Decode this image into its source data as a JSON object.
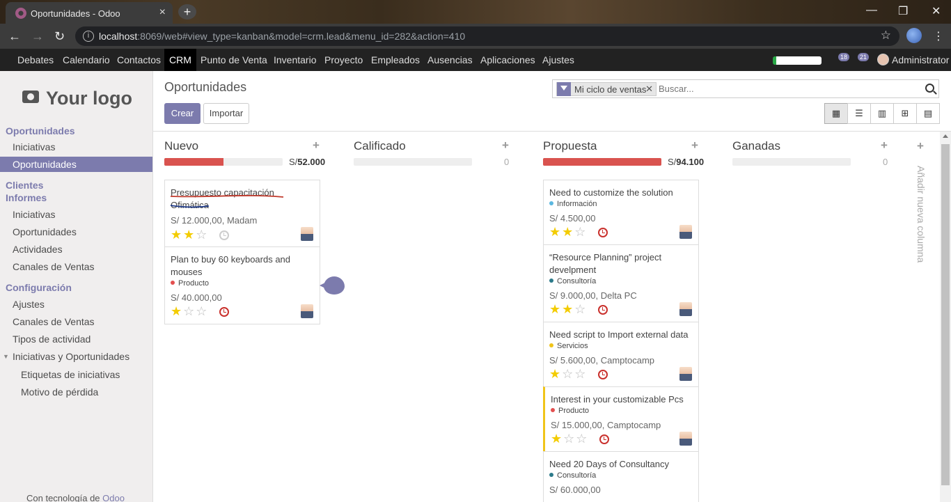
{
  "browser": {
    "tab_title": "Oportunidades - Odoo",
    "url_host": "localhost",
    "url_rest": ":8069/web#view_type=kanban&model=crm.lead&menu_id=282&action=410"
  },
  "topmenu": {
    "items": [
      "Debates",
      "Calendario",
      "Contactos",
      "CRM",
      "Punto de Venta",
      "Inventario",
      "Proyecto",
      "Empleados",
      "Ausencias",
      "Aplicaciones",
      "Ajustes"
    ],
    "active": "CRM",
    "activity_count": "18",
    "message_count": "21",
    "user": "Administrator"
  },
  "sidebar": {
    "logo": "Your logo",
    "items": [
      {
        "label": "Oportunidades",
        "type": "head"
      },
      {
        "label": "Iniciativas",
        "type": "l1"
      },
      {
        "label": "Oportunidades",
        "type": "l1",
        "active": true
      },
      {
        "label": "Clientes",
        "type": "head"
      },
      {
        "label": "Informes",
        "type": "head"
      },
      {
        "label": "Iniciativas",
        "type": "l1"
      },
      {
        "label": "Oportunidades",
        "type": "l1"
      },
      {
        "label": "Actividades",
        "type": "l1"
      },
      {
        "label": "Canales de Ventas",
        "type": "l1"
      },
      {
        "label": "Configuración",
        "type": "head"
      },
      {
        "label": "Ajustes",
        "type": "l1"
      },
      {
        "label": "Canales de Ventas",
        "type": "l1"
      },
      {
        "label": "Tipos de actividad",
        "type": "l1"
      },
      {
        "label": "Iniciativas y Oportunidades",
        "type": "l1",
        "caret": true
      },
      {
        "label": "Etiquetas de iniciativas",
        "type": "l2"
      },
      {
        "label": "Motivo de pérdida",
        "type": "l2"
      }
    ],
    "powered_prefix": "Con tecnología de",
    "powered_brand": "Odoo"
  },
  "control": {
    "title": "Oportunidades",
    "create_label": "Crear",
    "import_label": "Importar",
    "facet_label": "Mi ciclo de ventas",
    "search_placeholder": "Buscar..."
  },
  "kanban": {
    "columns": [
      {
        "title": "Nuevo",
        "sum": "52.000",
        "currency": "S/",
        "progress": 0.5
      },
      {
        "title": "Calificado",
        "sum": "0",
        "currency": "",
        "progress": 0
      },
      {
        "title": "Propuesta",
        "sum": "94.100",
        "currency": "S/",
        "progress": 1.0
      },
      {
        "title": "Ganadas",
        "sum": "0",
        "currency": "",
        "progress": 0
      }
    ],
    "add_column_label": "Añadir nueva columna",
    "cards": {
      "c1": {
        "name": "Presupuesto capacitación Ofimática",
        "amount": "S/ 12.000,00, Madam",
        "stars": 2,
        "clock": "none"
      },
      "c2": {
        "name": "Plan to buy 60 keyboards and mouses",
        "tag": "Producto",
        "tag_color": "#e34f4f",
        "amount": "S/ 40.000,00",
        "stars": 1,
        "clock": "overdue"
      },
      "p1": {
        "name": "Need to customize the solution",
        "tag": "Información",
        "tag_color": "#5bb7e0",
        "amount": "S/ 4.500,00",
        "stars": 2,
        "clock": "overdue"
      },
      "p2": {
        "name": "“Resource Planning” project develpment",
        "tag": "Consultoría",
        "tag_color": "#2c7a8a",
        "amount": "S/ 9.000,00, Delta PC",
        "stars": 2,
        "clock": "overdue"
      },
      "p3": {
        "name": "Need script to Import external data",
        "tag": "Servicios",
        "tag_color": "#f0c419",
        "amount": "S/ 5.600,00, Camptocamp",
        "stars": 1,
        "clock": "overdue"
      },
      "p4": {
        "name": "Interest in your customizable Pcs",
        "tag": "Producto",
        "tag_color": "#e34f4f",
        "amount": "S/ 15.000,00, Camptocamp",
        "stars": 1,
        "clock": "overdue"
      },
      "p5": {
        "name": "Need 20 Days of Consultancy",
        "tag": "Consultoría",
        "tag_color": "#2c7a8a",
        "amount": "S/ 60.000,00",
        "stars": 0,
        "clock": "overdue"
      }
    }
  }
}
